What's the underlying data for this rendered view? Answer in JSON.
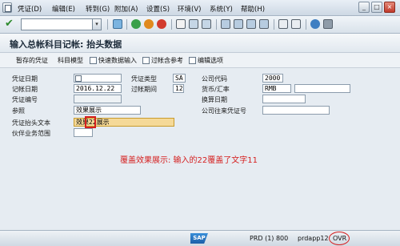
{
  "menubar": {
    "items": [
      "凭证(D)",
      "编辑(E)",
      "转到(G)",
      "附加(A)",
      "设置(S)",
      "环境(V)",
      "系统(Y)",
      "帮助(H)"
    ],
    "window_buttons": [
      "_",
      "□",
      "×"
    ]
  },
  "toolbar": {
    "command_field_value": "",
    "dropdown_glyph": "▾",
    "ok_glyph": "✔"
  },
  "title": "输入总帐科目记帐: 抬头数据",
  "app_toolbar": {
    "items": [
      "暂存的凭证",
      "科目模型",
      "快速数据输入",
      "过帐含参考",
      "编辑选项"
    ]
  },
  "form": {
    "doc_date_label": "凭证日期",
    "doc_date_value": "",
    "doc_type_label": "凭证类型",
    "doc_type_value": "SA",
    "company_code_label": "公司代码",
    "company_code_value": "2000",
    "post_date_label": "记帐日期",
    "post_date_value": "2016.12.22",
    "period_label": "过帐期间",
    "period_value": "12",
    "currency_label": "货币/汇率",
    "currency_value": "RMB",
    "doc_no_label": "凭证编号",
    "doc_no_value": "",
    "translation_date_label": "换算日期",
    "translation_date_value": "",
    "reference_label": "参照",
    "reference_value": "效果展示",
    "cross_cc_label": "公司往来凭证号",
    "cross_cc_value": "",
    "header_text_label": "凭证抬头文本",
    "header_text_value": "效果22展示",
    "partner_label": "伙伴业务范围",
    "partner_value": ""
  },
  "annotation": "覆盖效果展示: 输入的22覆盖了文字11",
  "status": {
    "system": "PRD (1) 800",
    "server": "prdapp12",
    "mode": "OVR"
  },
  "colors": {
    "accent_red": "#d51f1f",
    "highlight": "#f5d998"
  }
}
